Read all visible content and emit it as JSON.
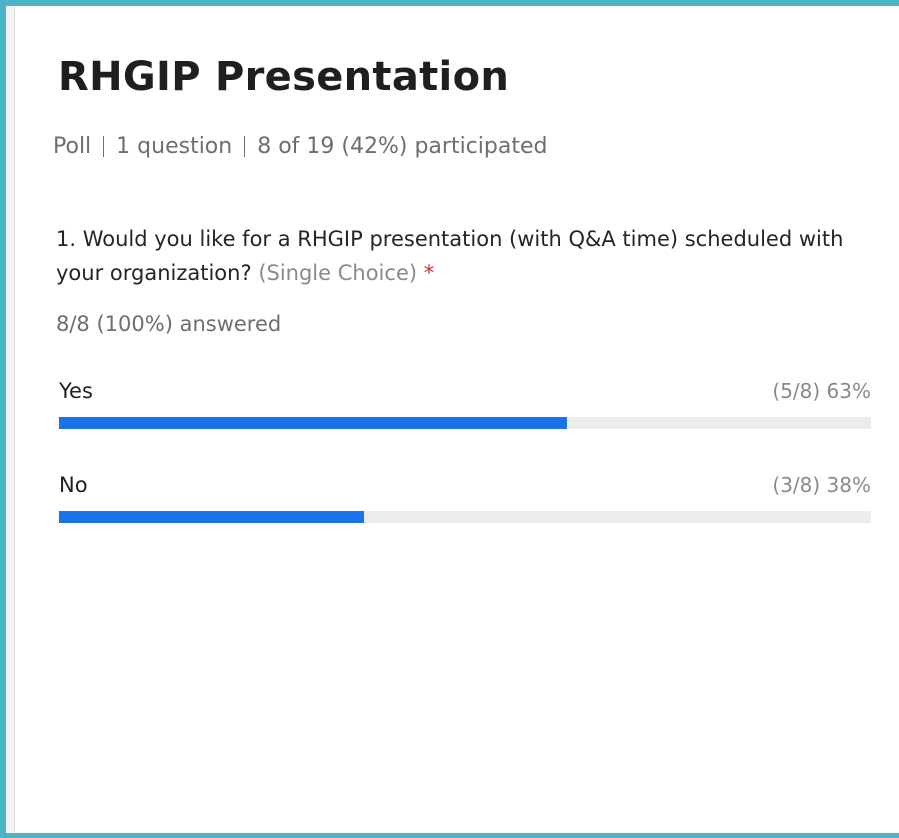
{
  "poll": {
    "title": "RHGIP Presentation",
    "meta": {
      "type": "Poll",
      "questions": "1 question",
      "participation": "8 of 19 (42%) participated"
    },
    "question": {
      "text": "1. Would you like for a RHGIP presentation (with Q&A time) scheduled with your organization?",
      "type_label": "(Single Choice)",
      "required_mark": "*",
      "answered": "8/8 (100%) answered",
      "options": [
        {
          "label": "Yes",
          "stat": "(5/8) 63%",
          "fraction": 0.625
        },
        {
          "label": "No",
          "stat": "(3/8) 38%",
          "fraction": 0.375
        }
      ]
    }
  },
  "colors": {
    "frame_border": "#4bb5c8",
    "bar_fill": "#1a73e8",
    "bar_track": "#ececec",
    "required": "#e0301e"
  }
}
